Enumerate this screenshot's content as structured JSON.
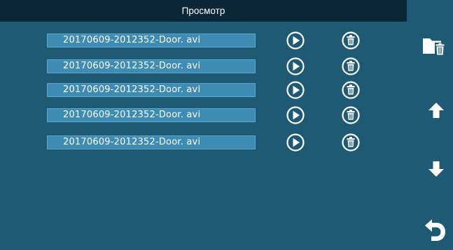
{
  "header": {
    "title": "Просмотр"
  },
  "files": [
    {
      "name": "20170609-2012352-Door. avi"
    },
    {
      "name": "20170609-2012352-Door. avi"
    },
    {
      "name": "20170609-2012352-Door. avi"
    },
    {
      "name": "20170609-2012352-Door. avi"
    },
    {
      "name": "20170609-2012352-Door. avi"
    }
  ],
  "sidebar": {
    "buttons": [
      {
        "icon": "folder-delete-icon"
      },
      {
        "icon": "arrow-up-icon"
      },
      {
        "icon": "arrow-down-icon"
      },
      {
        "icon": "back-icon"
      }
    ]
  },
  "colors": {
    "background": "#1f5a75",
    "titlebar": "#0b2636",
    "file_field": "#3e8bb3",
    "icon": "#ffffff"
  }
}
